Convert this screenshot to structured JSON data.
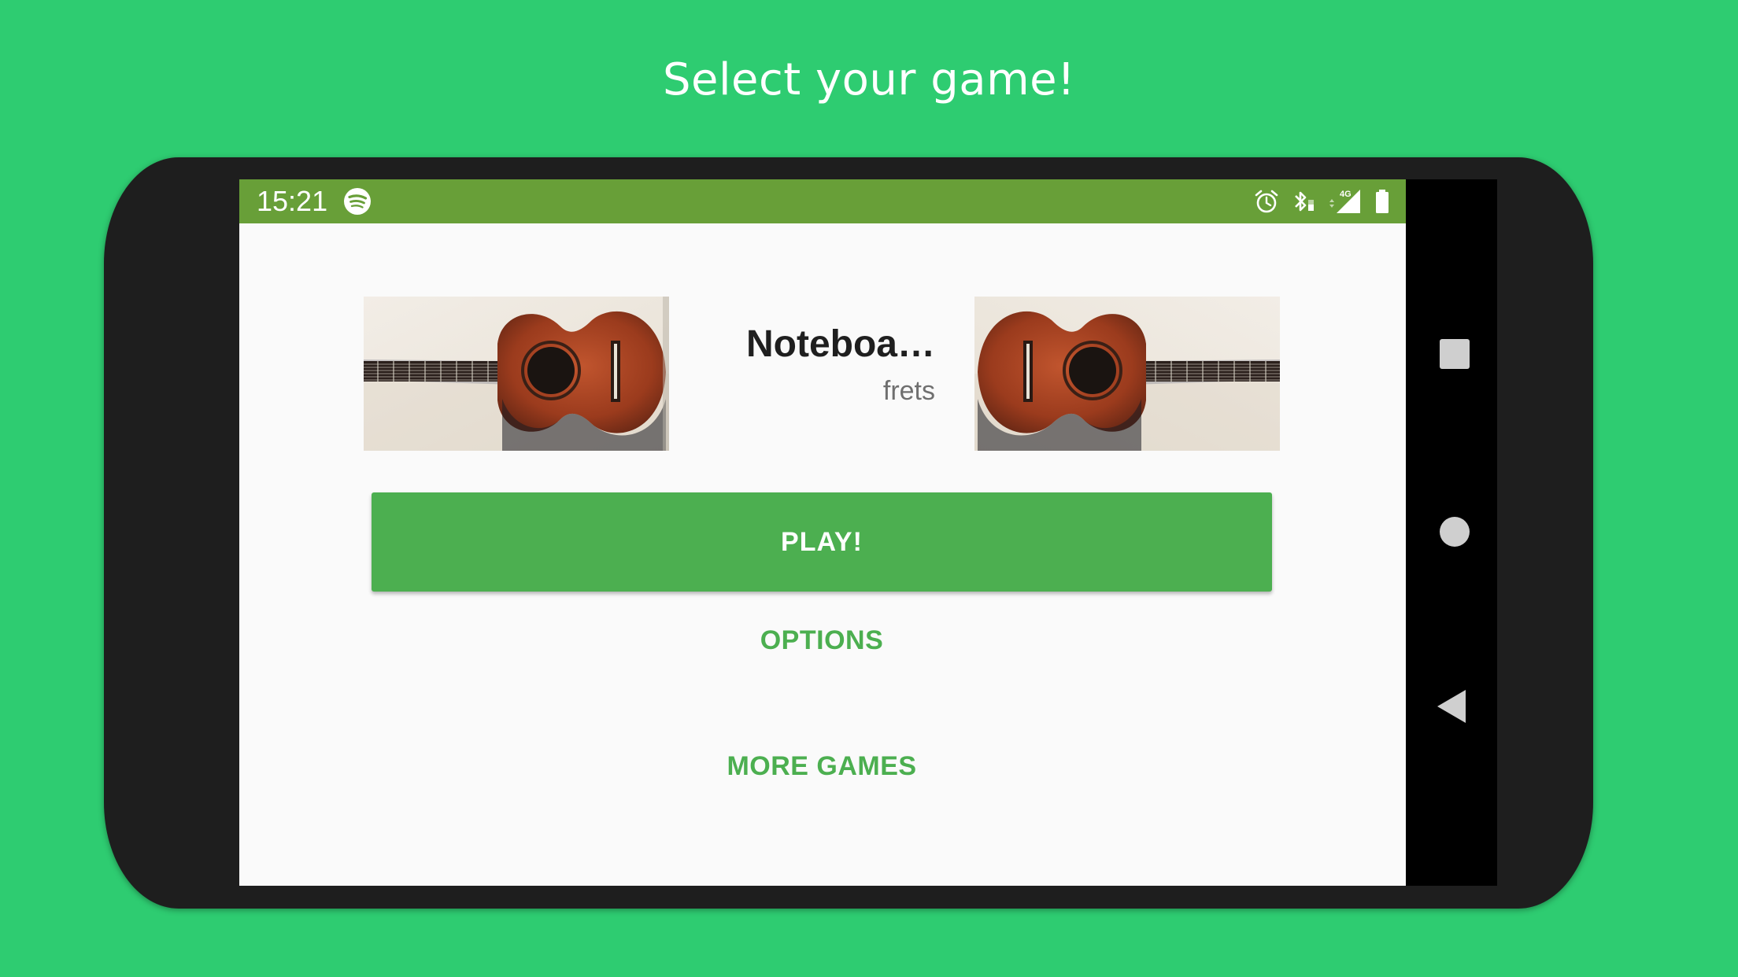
{
  "page": {
    "headline": "Select your game!",
    "background_color": "#2ecc71"
  },
  "statusbar": {
    "time": "15:21",
    "color": "#689f38",
    "icons": [
      "spotify-icon",
      "alarm-icon",
      "bluetooth-icon",
      "4g-signal-icon",
      "battery-icon"
    ],
    "network_label": "4G"
  },
  "game": {
    "title": "Noteboa…",
    "subtitle": "frets",
    "cover_left": "guitar-image",
    "cover_right": "guitar-image"
  },
  "buttons": {
    "play": "PLAY!",
    "options": "OPTIONS",
    "more_games": "MORE GAMES",
    "accent_color": "#4caf50"
  },
  "navbar": {
    "items": [
      "recents-square-icon",
      "home-circle-icon",
      "back-triangle-icon"
    ]
  }
}
